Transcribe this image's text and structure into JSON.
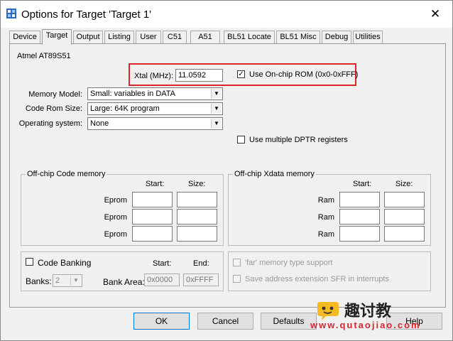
{
  "window": {
    "title": "Options for Target 'Target 1'",
    "close": "✕"
  },
  "tabs": [
    "Device",
    "Target",
    "Output",
    "Listing",
    "User",
    "C51",
    "A51",
    "BL51 Locate",
    "BL51 Misc",
    "Debug",
    "Utilities"
  ],
  "active_tab": "Target",
  "device": "Atmel AT89S51",
  "xtal": {
    "label": "Xtal (MHz):",
    "value": "11.0592"
  },
  "onchip_rom": {
    "label": "Use On-chip ROM (0x0-0xFFF)",
    "checked": true,
    "mark": "✓"
  },
  "memory_model": {
    "label": "Memory Model:",
    "value": "Small: variables in DATA"
  },
  "code_rom_size": {
    "label": "Code Rom Size:",
    "value": "Large: 64K program"
  },
  "os": {
    "label": "Operating system:",
    "value": "None"
  },
  "dptr": {
    "label": "Use multiple DPTR registers"
  },
  "offchip_code": {
    "title": "Off-chip Code memory",
    "start_header": "Start:",
    "size_header": "Size:",
    "rows": [
      "Eprom",
      "Eprom",
      "Eprom"
    ]
  },
  "offchip_xdata": {
    "title": "Off-chip Xdata memory",
    "start_header": "Start:",
    "size_header": "Size:",
    "rows": [
      "Ram",
      "Ram",
      "Ram"
    ]
  },
  "code_banking": {
    "label": "Code Banking",
    "start_header": "Start:",
    "end_header": "End:",
    "banks_label": "Banks:",
    "banks_value": "2",
    "bank_area_label": "Bank Area:",
    "bank_area_start": "0x0000",
    "bank_area_end": "0xFFFF"
  },
  "far_memory": {
    "label": "'far' memory type support"
  },
  "save_sfr": {
    "label": "Save address extension SFR in interrupts"
  },
  "buttons": {
    "ok": "OK",
    "cancel": "Cancel",
    "defaults": "Defaults",
    "help": "Help"
  },
  "watermark": {
    "name": "趣讨教",
    "url": "www.qutaojiao.com"
  },
  "colors": {
    "highlight": "#d9262b",
    "watermark": "#d9262b"
  }
}
